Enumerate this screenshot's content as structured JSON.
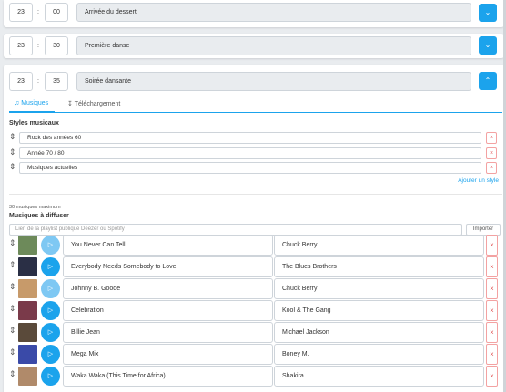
{
  "events": [
    {
      "hour": "23",
      "minute": "00",
      "title": "Arrivée du dessert",
      "expanded": false
    },
    {
      "hour": "23",
      "minute": "30",
      "title": "Première danse",
      "expanded": false
    },
    {
      "hour": "23",
      "minute": "35",
      "title": "Soirée dansante",
      "expanded": true
    }
  ],
  "separator": ":",
  "icons": {
    "chevron_down": "chevron-down-icon",
    "chevron_up": "chevron-up-icon",
    "drag": "drag-handle-icon",
    "close": "close-icon",
    "play": "play-icon",
    "music": "music-note-icon",
    "download": "download-icon"
  },
  "tabs": {
    "music": "Musiques",
    "download": "Téléchargement"
  },
  "styles_section": {
    "title": "Styles musicaux",
    "styles": [
      "Rock des années 60",
      "Année 70 / 80",
      "Musiques actuelles"
    ],
    "add_label": "Ajouter un style"
  },
  "music_section": {
    "max_note": "30 musiques maximum",
    "title": "Musiques à diffuser",
    "playlist_placeholder": "Lien de la playlist publique Deezer ou Spotify",
    "import_label": "Importer",
    "tracks": [
      {
        "title": "You Never Can Tell",
        "artist": "Chuck Berry",
        "playing": false,
        "cover": "#6d8a5a"
      },
      {
        "title": "Everybody Needs Somebody to Love",
        "artist": "The Blues Brothers",
        "playing": true,
        "cover": "#2a2f45"
      },
      {
        "title": "Johnny B. Goode",
        "artist": "Chuck Berry",
        "playing": false,
        "cover": "#c79a6a"
      },
      {
        "title": "Celebration",
        "artist": "Kool & The Gang",
        "playing": true,
        "cover": "#7a3a4a"
      },
      {
        "title": "Billie Jean",
        "artist": "Michael Jackson",
        "playing": true,
        "cover": "#5a4a3a"
      },
      {
        "title": "Mega Mix",
        "artist": "Boney M.",
        "playing": true,
        "cover": "#3a4aa8"
      },
      {
        "title": "Waka Waka (This Time for Africa)",
        "artist": "Shakira",
        "playing": true,
        "cover": "#b08a6a"
      }
    ]
  },
  "colors": {
    "accent": "#1ba3ec",
    "accent_light": "#7ec8f3",
    "danger": "#e05a5a"
  }
}
